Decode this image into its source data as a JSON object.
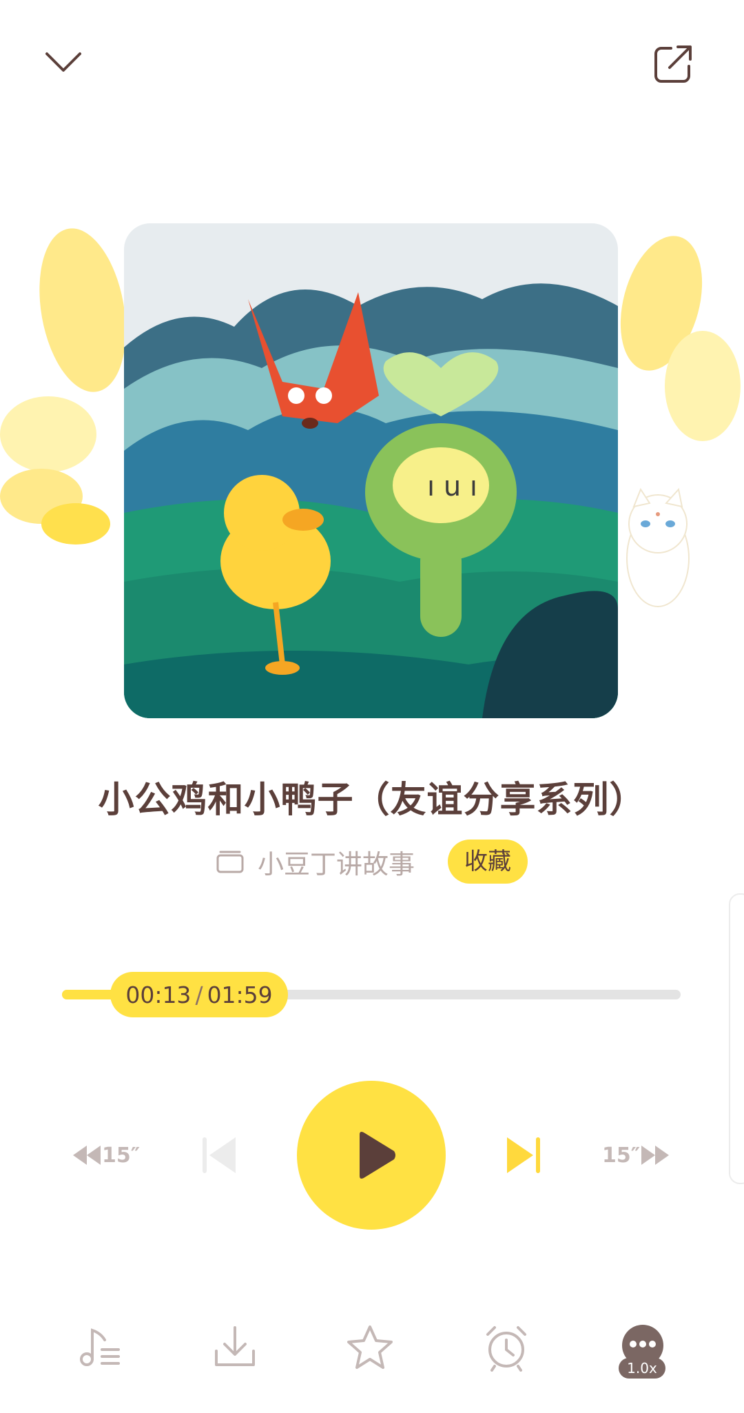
{
  "header": {
    "collapse_icon": "chevron-down-icon",
    "share_icon": "share-external-icon"
  },
  "cover": {
    "description_icon": "story-cover-illustration"
  },
  "track": {
    "title": "小公鸡和小鸭子（友谊分享系列）",
    "album_name": "小豆丁讲故事",
    "favorite_label": "收藏"
  },
  "progress": {
    "current": "00:13",
    "separator": "/",
    "total": "01:59",
    "fraction": 0.11
  },
  "controls": {
    "rewind_label": "15″",
    "forward_label": "15″"
  },
  "toolbar": {
    "speed": "1.0x",
    "items": [
      "playlist-icon",
      "download-icon",
      "star-icon",
      "alarm-clock-icon",
      "more-icon"
    ]
  },
  "colors": {
    "accent": "#ffe143",
    "text_dark": "#5b3f3a",
    "text_muted": "#b8a9a6",
    "icon_muted": "#c4b8b6"
  }
}
